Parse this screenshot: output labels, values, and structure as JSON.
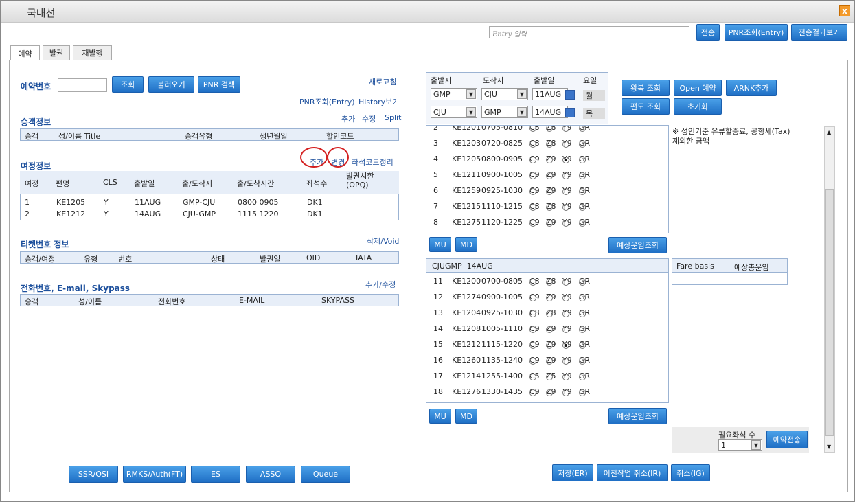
{
  "window": {
    "title": "국내선",
    "close": "x"
  },
  "top": {
    "entry_placeholder": "Entry 입력",
    "send": "전송",
    "pnr_entry": "PNR조회(Entry)",
    "send_result": "전송결과보기"
  },
  "tabs": [
    "예약",
    "발권",
    "재발행"
  ],
  "left": {
    "booking_label": "예약번호",
    "lookup": "조회",
    "load": "불러오기",
    "pnr_search": "PNR 검색",
    "refresh": "새로고침",
    "pnr_entry_link": "PNR조회(Entry)",
    "history": "History보기",
    "pax": {
      "title": "승객정보",
      "add": "추가",
      "edit": "수정",
      "split": "Split",
      "cols": [
        "승객",
        "성/이름 Title",
        "승객유형",
        "생년월일",
        "할인코드"
      ]
    },
    "itin": {
      "title": "여정정보",
      "add": "추가",
      "change": "변경",
      "seatcode": "좌석코드정리",
      "cols": [
        "여정",
        "편명",
        "CLS",
        "출발일",
        "출/도착지",
        "출/도착시간",
        "좌석수",
        "발권시한\n(OPQ)"
      ],
      "rows": [
        [
          "1",
          "KE1205",
          "Y",
          "11AUG",
          "GMP-CJU",
          "0800 0905",
          "DK1"
        ],
        [
          "2",
          "KE1212",
          "Y",
          "14AUG",
          "CJU-GMP",
          "1115 1220",
          "DK1"
        ]
      ]
    },
    "ticket": {
      "title": "티켓번호 정보",
      "action": "삭제/Void",
      "cols": [
        "승객/여정",
        "유형",
        "번호",
        "상태",
        "발권일",
        "OID",
        "IATA"
      ]
    },
    "contact": {
      "title": "전화번호, E-mail, Skypass",
      "action": "추가/수정",
      "cols": [
        "승객",
        "성/이름",
        "전화번호",
        "E-MAIL",
        "SKYPASS"
      ]
    },
    "bottom_buttons": [
      "SSR/OSI",
      "RMKS/Auth(FT)",
      "ES",
      "ASSO",
      "Queue"
    ]
  },
  "search": {
    "cols": [
      "출발지",
      "도착지",
      "출발일",
      "요일"
    ],
    "rows": [
      {
        "from": "GMP",
        "to": "CJU",
        "date": "11AUG",
        "day": "월"
      },
      {
        "from": "CJU",
        "to": "GMP",
        "date": "14AUG",
        "day": "목"
      }
    ],
    "buttons": [
      "왕복 조회",
      "Open 예약",
      "ARNK추가",
      "편도 조회",
      "초기화"
    ]
  },
  "out_flights": [
    {
      "n": "2",
      "f": "KE1201",
      "t": "0705-0810",
      "c": [
        "C8",
        "Z8",
        "Y9",
        "GR"
      ],
      "sel": -1
    },
    {
      "n": "3",
      "f": "KE1203",
      "t": "0720-0825",
      "c": [
        "C8",
        "Z8",
        "Y9",
        "GR"
      ],
      "sel": -1
    },
    {
      "n": "4",
      "f": "KE1205",
      "t": "0800-0905",
      "c": [
        "C9",
        "Z9",
        "Y9",
        "GR"
      ],
      "sel": 2
    },
    {
      "n": "5",
      "f": "KE1211",
      "t": "0900-1005",
      "c": [
        "C9",
        "Z9",
        "Y9",
        "GR"
      ],
      "sel": -1
    },
    {
      "n": "6",
      "f": "KE1259",
      "t": "0925-1030",
      "c": [
        "C9",
        "Z9",
        "Y9",
        "GR"
      ],
      "sel": -1
    },
    {
      "n": "7",
      "f": "KE1215",
      "t": "1110-1215",
      "c": [
        "C8",
        "Z8",
        "Y9",
        "GR"
      ],
      "sel": -1
    },
    {
      "n": "8",
      "f": "KE1275",
      "t": "1120-1225",
      "c": [
        "C9",
        "Z9",
        "Y9",
        "GR"
      ],
      "sel": -1
    }
  ],
  "ret_header": "CJUGMP  14AUG",
  "ret_flights": [
    {
      "n": "11",
      "f": "KE1200",
      "t": "0700-0805",
      "c": [
        "C8",
        "Z8",
        "Y9",
        "GR"
      ],
      "sel": -1
    },
    {
      "n": "12",
      "f": "KE1274",
      "t": "0900-1005",
      "c": [
        "C9",
        "Z9",
        "Y9",
        "GR"
      ],
      "sel": -1
    },
    {
      "n": "13",
      "f": "KE1204",
      "t": "0925-1030",
      "c": [
        "C8",
        "Z8",
        "Y9",
        "GR"
      ],
      "sel": -1
    },
    {
      "n": "14",
      "f": "KE1208",
      "t": "1005-1110",
      "c": [
        "C9",
        "Z9",
        "Y9",
        "GR"
      ],
      "sel": -1
    },
    {
      "n": "15",
      "f": "KE1212",
      "t": "1115-1220",
      "c": [
        "C9",
        "Z9",
        "Y9",
        "GR"
      ],
      "sel": 2
    },
    {
      "n": "16",
      "f": "KE1260",
      "t": "1135-1240",
      "c": [
        "C9",
        "Z9",
        "Y9",
        "GR"
      ],
      "sel": -1
    },
    {
      "n": "17",
      "f": "KE1214",
      "t": "1255-1400",
      "c": [
        "C5",
        "Z5",
        "Y9",
        "GR"
      ],
      "sel": -1
    },
    {
      "n": "18",
      "f": "KE1276",
      "t": "1330-1435",
      "c": [
        "C9",
        "Z9",
        "Y9",
        "GR"
      ],
      "sel": -1
    }
  ],
  "mu": "MU",
  "md": "MD",
  "fare_lookup": "예상운임조회",
  "note": "※ 성인기준 유류할증료, 공항세(Tax)\n제외한 금액",
  "fare": {
    "basis": "Fare basis",
    "total": "예상총운임"
  },
  "seats": {
    "label": "필요좌석 수",
    "value": "1",
    "send": "예약전송"
  },
  "actions": [
    "저장(ER)",
    "이전작업 취소(IR)",
    "취소(IG)"
  ]
}
